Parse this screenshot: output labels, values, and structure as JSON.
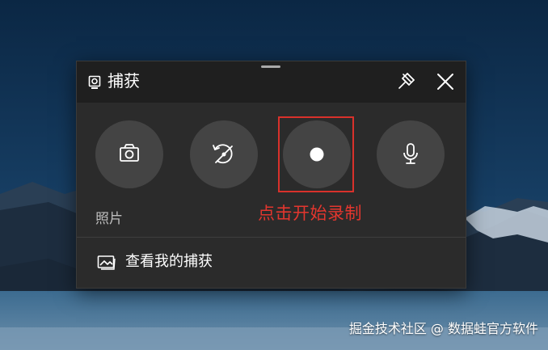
{
  "widget": {
    "title": "捕获",
    "buttons": [
      {
        "id": "screenshot",
        "icon": "camera-icon"
      },
      {
        "id": "record-last",
        "icon": "record-last-30s-icon"
      },
      {
        "id": "start-recording",
        "icon": "record-dot-icon"
      },
      {
        "id": "microphone",
        "icon": "microphone-icon"
      }
    ],
    "caption": "照片",
    "gallery_label": "查看我的捕获"
  },
  "annotation": {
    "hint": "点击开始录制",
    "color": "#e3362e"
  },
  "watermark": "掘金技术社区 @ 数据蛙官方软件"
}
